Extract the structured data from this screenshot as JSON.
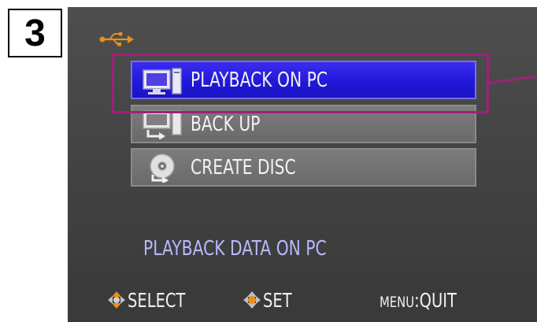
{
  "step_number": "3",
  "header": {
    "icon": "usb-icon"
  },
  "menu": {
    "items": [
      {
        "label": "PLAYBACK ON PC",
        "icon": "pc-monitor-icon",
        "selected": true
      },
      {
        "label": "BACK UP",
        "icon": "pc-backup-icon",
        "selected": false
      },
      {
        "label": "CREATE DISC",
        "icon": "disc-icon",
        "selected": false
      }
    ]
  },
  "description": "PLAYBACK DATA ON PC",
  "footer": {
    "select_label": "SELECT",
    "set_label": "SET",
    "menu_key": "MENU",
    "quit_label": ":QUIT"
  },
  "colors": {
    "selected_bg": "#2018d6",
    "item_bg": "#6a6a6a",
    "highlight": "#a0207a",
    "description_text": "#b8b8ff",
    "usb_orange": "#e8901a"
  }
}
